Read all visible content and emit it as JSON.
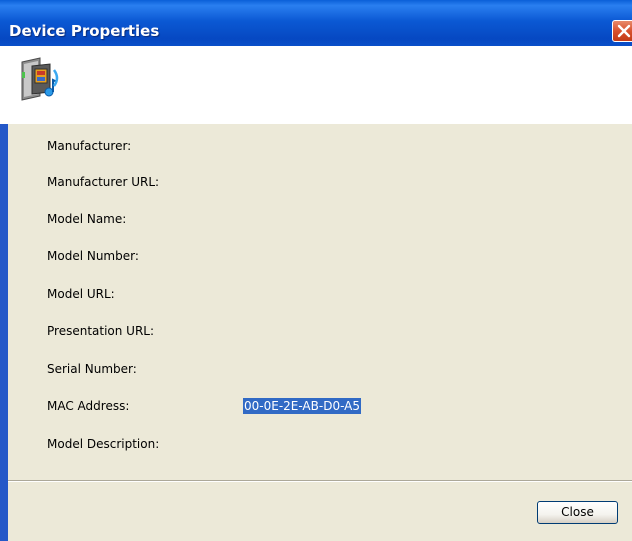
{
  "window": {
    "title": "Device Properties"
  },
  "properties": [
    {
      "label": "Manufacturer:",
      "value": ""
    },
    {
      "label": "Manufacturer URL:",
      "value": ""
    },
    {
      "label": "Model Name:",
      "value": ""
    },
    {
      "label": "Model Number:",
      "value": ""
    },
    {
      "label": "Model URL:",
      "value": ""
    },
    {
      "label": "Presentation URL:",
      "value": ""
    },
    {
      "label": "Serial Number:",
      "value": ""
    },
    {
      "label": "MAC Address:",
      "value": "00-0E-2E-AB-D0-A5"
    },
    {
      "label": "Model Description:",
      "value": ""
    }
  ],
  "footer": {
    "close_label": "Close"
  },
  "icons": {
    "titlebar_close": "close-icon",
    "device": "media-device-icon"
  },
  "colors": {
    "titlebar": "#0b59d4",
    "dialog_background": "#ece9d8",
    "selection": "#316ac5",
    "close_button_red": "#d8512e"
  }
}
